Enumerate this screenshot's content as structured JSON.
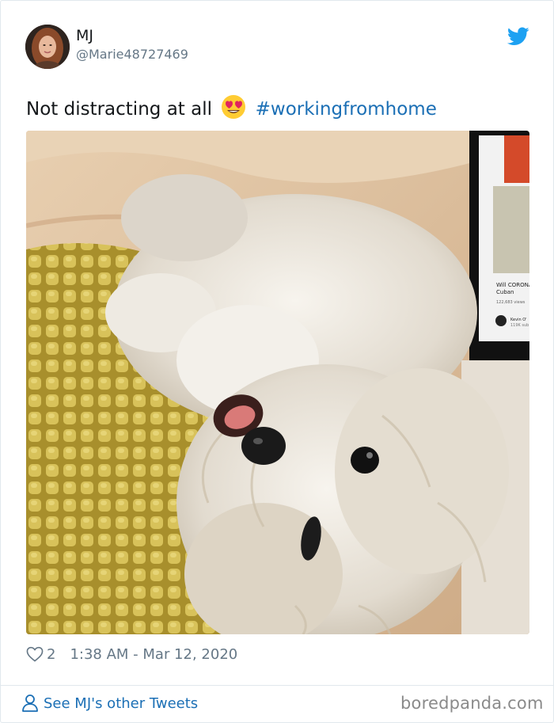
{
  "tweet": {
    "author_name": "MJ",
    "author_handle": "@Marie48727469",
    "text_before_emoji": "Not distracting at all",
    "emoji": "smiling-face-with-heart-eyes",
    "hashtag": "#workingfromhome",
    "like_count": "2",
    "timestamp": "1:38 AM - Mar 12, 2020",
    "photo_laptop_text": {
      "title_line1": "Will CORONA",
      "title_line2": "Cuban",
      "views": "122,683 views",
      "channel": "Kevin O'",
      "subs": "119K sub"
    }
  },
  "footer": {
    "other_tweets_label": "See MJ's other Tweets",
    "watermark": "boredpanda.com"
  },
  "colors": {
    "link": "#1b6fb5",
    "twitter_blue": "#1da1f2",
    "muted": "#657786"
  }
}
